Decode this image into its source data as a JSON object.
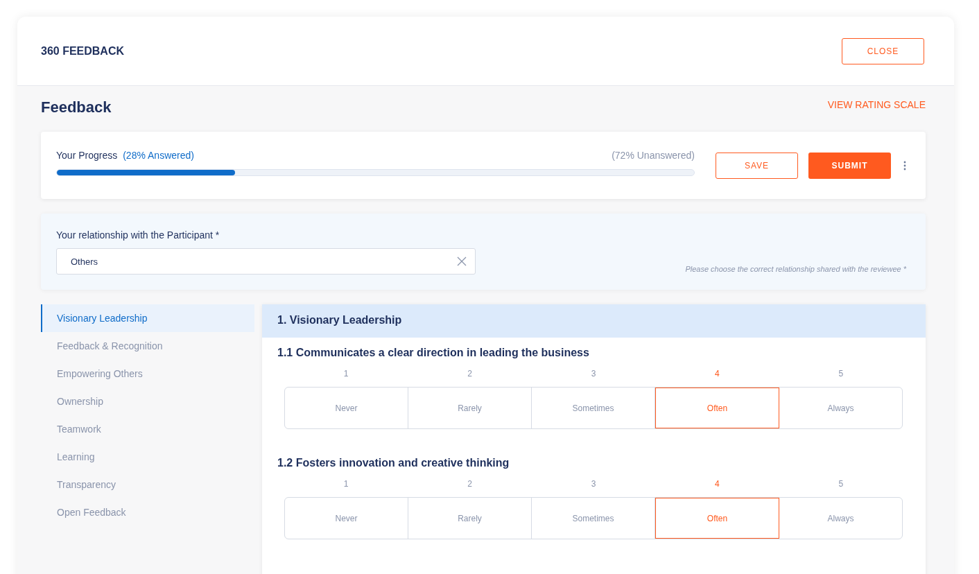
{
  "header": {
    "title": "360 FEEDBACK",
    "close_button": "CLOSE"
  },
  "page": {
    "title": "Feedback",
    "rating_scale_link": "VIEW RATING SCALE"
  },
  "progress": {
    "label": "Your Progress",
    "answered": "(28% Answered)",
    "unanswered": "(72% Unanswered)",
    "level": 0.28,
    "save_button": "SAVE",
    "submit_button": "SUBMIT"
  },
  "relationship": {
    "label": "Your relationship with the Participant *",
    "value": "Others",
    "hint": "Please choose the correct relationship shared with the reviewee *"
  },
  "sidebar": {
    "items": [
      {
        "label": "Visionary Leadership",
        "selected": true
      },
      {
        "label": "Feedback & Recognition",
        "selected": false
      },
      {
        "label": "Empowering Others",
        "selected": false
      },
      {
        "label": "Ownership",
        "selected": false
      },
      {
        "label": "Teamwork",
        "selected": false
      },
      {
        "label": "Learning",
        "selected": false
      },
      {
        "label": "Transparency",
        "selected": false
      },
      {
        "label": "Open Feedback",
        "selected": false
      }
    ]
  },
  "section": {
    "title": "1. Visionary Leadership",
    "questions": [
      {
        "text": "1.1 Communicates a clear direction in leading the business",
        "options": [
          {
            "number": "1",
            "label": "Never",
            "selected": false
          },
          {
            "number": "2",
            "label": "Rarely",
            "selected": false
          },
          {
            "number": "3",
            "label": "Sometimes",
            "selected": false
          },
          {
            "number": "4",
            "label": "Often",
            "selected": true
          },
          {
            "number": "5",
            "label": "Always",
            "selected": false
          }
        ]
      },
      {
        "text": "1.2 Fosters innovation and creative thinking",
        "options": [
          {
            "number": "1",
            "label": "Never",
            "selected": false
          },
          {
            "number": "2",
            "label": "Rarely",
            "selected": false
          },
          {
            "number": "3",
            "label": "Sometimes",
            "selected": false
          },
          {
            "number": "4",
            "label": "Often",
            "selected": true
          },
          {
            "number": "5",
            "label": "Always",
            "selected": false
          }
        ]
      }
    ]
  }
}
